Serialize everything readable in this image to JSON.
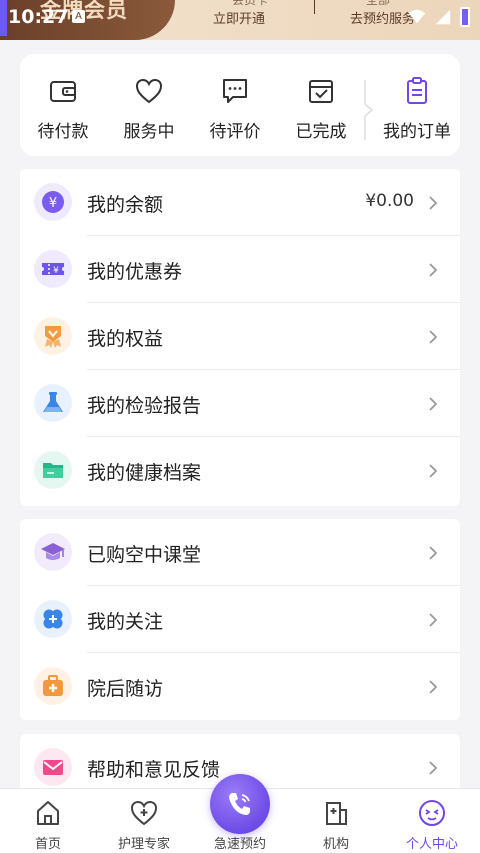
{
  "status_bar": {
    "time": "10:27",
    "badge": "A"
  },
  "banner": {
    "title": "金牌会员",
    "action_left": "立即开通",
    "action_right": "去预约服务",
    "ghost_left": "会员卡",
    "ghost_right": "全部"
  },
  "orders": {
    "items": [
      {
        "label": "待付款",
        "icon": "wallet-icon"
      },
      {
        "label": "服务中",
        "icon": "heart-icon"
      },
      {
        "label": "待评价",
        "icon": "comment-icon"
      },
      {
        "label": "已完成",
        "icon": "calendar-check-icon"
      }
    ],
    "all_label": "我的订单",
    "all_icon": "clipboard-icon"
  },
  "menu_group_1": [
    {
      "label": "我的余额",
      "value": "¥0.00",
      "icon": "yen-icon",
      "color": "#7b5cf0",
      "bg": "#efeafe"
    },
    {
      "label": "我的优惠券",
      "value": "",
      "icon": "coupon-icon",
      "color": "#6d56e6",
      "bg": "#efeafe"
    },
    {
      "label": "我的权益",
      "value": "",
      "icon": "medal-icon",
      "color": "#f39a3d",
      "bg": "#fff1e4"
    },
    {
      "label": "我的检验报告",
      "value": "",
      "icon": "flask-icon",
      "color": "#3a86e8",
      "bg": "#e8f1fd"
    },
    {
      "label": "我的健康档案",
      "value": "",
      "icon": "folder-icon",
      "color": "#25b58a",
      "bg": "#e4f7f0"
    }
  ],
  "menu_group_2": [
    {
      "label": "已购空中课堂",
      "icon": "graduation-cap-icon",
      "color": "#8a62d6",
      "bg": "#f1ebfb"
    },
    {
      "label": "我的关注",
      "icon": "clover-icon",
      "color": "#3a86e8",
      "bg": "#e8f1fd"
    },
    {
      "label": "院后随访",
      "icon": "medical-kit-icon",
      "color": "#f39a3d",
      "bg": "#fff1e4"
    }
  ],
  "menu_group_3": [
    {
      "label": "帮助和意见反馈",
      "icon": "mail-icon",
      "color": "#f04a8c",
      "bg": "#fde8f1"
    }
  ],
  "fab": {
    "label": "急速预约",
    "icon": "phone-icon"
  },
  "bottom_nav": [
    {
      "label": "首页",
      "icon": "home-icon",
      "active": false
    },
    {
      "label": "护理专家",
      "icon": "nurse-heart-icon",
      "active": false
    },
    {
      "label": "急速预约",
      "icon": "phone-icon",
      "active": false
    },
    {
      "label": "机构",
      "icon": "building-icon",
      "active": false
    },
    {
      "label": "个人中心",
      "icon": "profile-face-icon",
      "active": true
    }
  ],
  "colors": {
    "accent": "#7048e8",
    "background": "#f4f4f6"
  }
}
